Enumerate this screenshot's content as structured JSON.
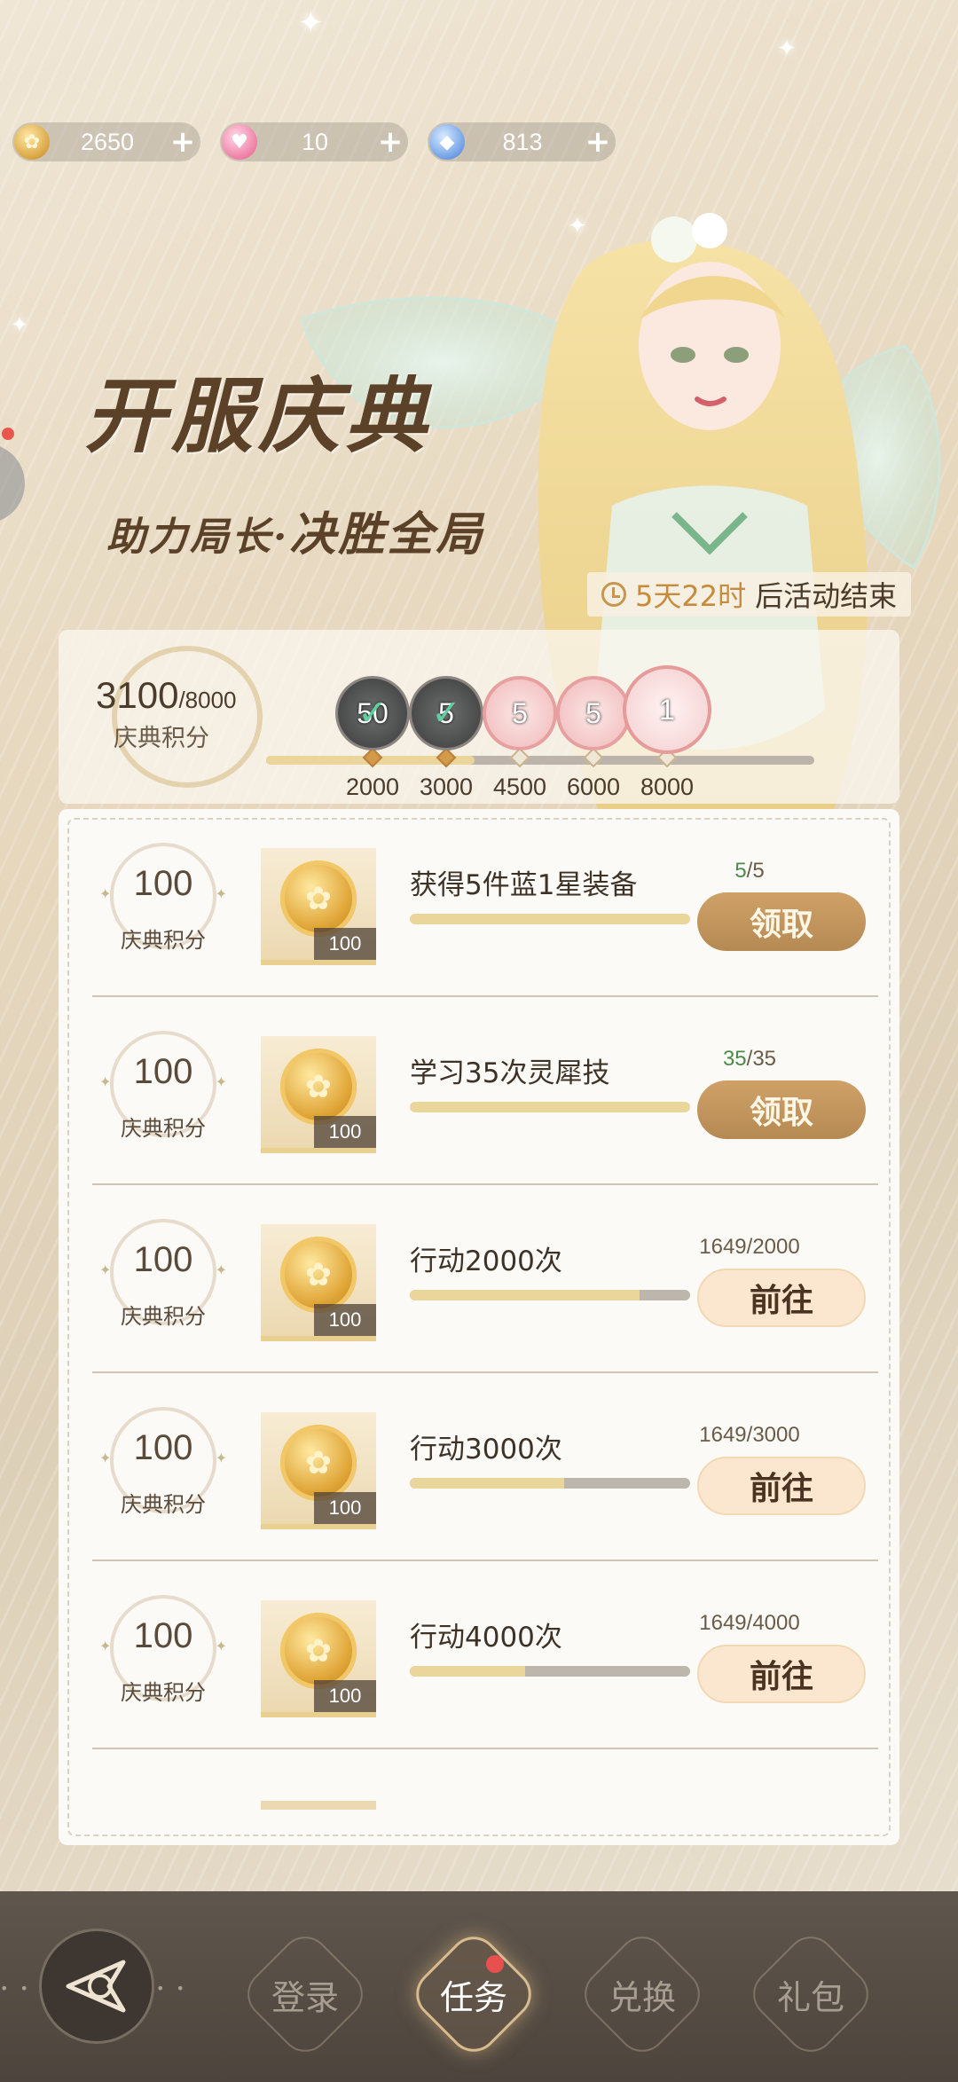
{
  "currencies": [
    {
      "icon": "gold-coin-icon",
      "value": "2650"
    },
    {
      "icon": "pink-heart-gem-icon",
      "value": "10"
    },
    {
      "icon": "blue-diamond-icon",
      "value": "813"
    }
  ],
  "banner": {
    "title": "开服庆典",
    "subtitle_a": "助力局长·",
    "subtitle_b": "决胜全局",
    "timer_value": "5天22时",
    "timer_suffix": "后活动结束"
  },
  "points": {
    "current": "3100",
    "max": "/8000",
    "label": "庆典积分",
    "progress_fraction": 0.38,
    "milestones": [
      {
        "value": "2000",
        "reward_count": "50",
        "state": "claimed"
      },
      {
        "value": "3000",
        "reward_count": "5",
        "state": "claimed"
      },
      {
        "value": "4500",
        "reward_count": "5",
        "state": "pending"
      },
      {
        "value": "6000",
        "reward_count": "5",
        "state": "pending"
      },
      {
        "value": "8000",
        "reward_count": "1",
        "state": "pending"
      }
    ]
  },
  "tasks": [
    {
      "points": "100",
      "points_label": "庆典积分",
      "item_count": "100",
      "name": "获得5件蓝1星装备",
      "cur": "5",
      "total": "/5",
      "progress": 1.0,
      "button": "领取",
      "state": "claim"
    },
    {
      "points": "100",
      "points_label": "庆典积分",
      "item_count": "100",
      "name": "学习35次灵犀技",
      "cur": "35",
      "total": "/35",
      "progress": 1.0,
      "button": "领取",
      "state": "claim"
    },
    {
      "points": "100",
      "points_label": "庆典积分",
      "item_count": "100",
      "name": "行动2000次",
      "cur": "1649",
      "total": "/2000",
      "progress": 0.82,
      "button": "前往",
      "state": "go"
    },
    {
      "points": "100",
      "points_label": "庆典积分",
      "item_count": "100",
      "name": "行动3000次",
      "cur": "1649",
      "total": "/3000",
      "progress": 0.55,
      "button": "前往",
      "state": "go"
    },
    {
      "points": "100",
      "points_label": "庆典积分",
      "item_count": "100",
      "name": "行动4000次",
      "cur": "1649",
      "total": "/4000",
      "progress": 0.41,
      "button": "前往",
      "state": "go"
    }
  ],
  "nav": {
    "tabs": [
      {
        "label": "登录",
        "active": false
      },
      {
        "label": "任务",
        "active": true
      },
      {
        "label": "兑换",
        "active": false
      },
      {
        "label": "礼包",
        "active": false
      }
    ]
  }
}
